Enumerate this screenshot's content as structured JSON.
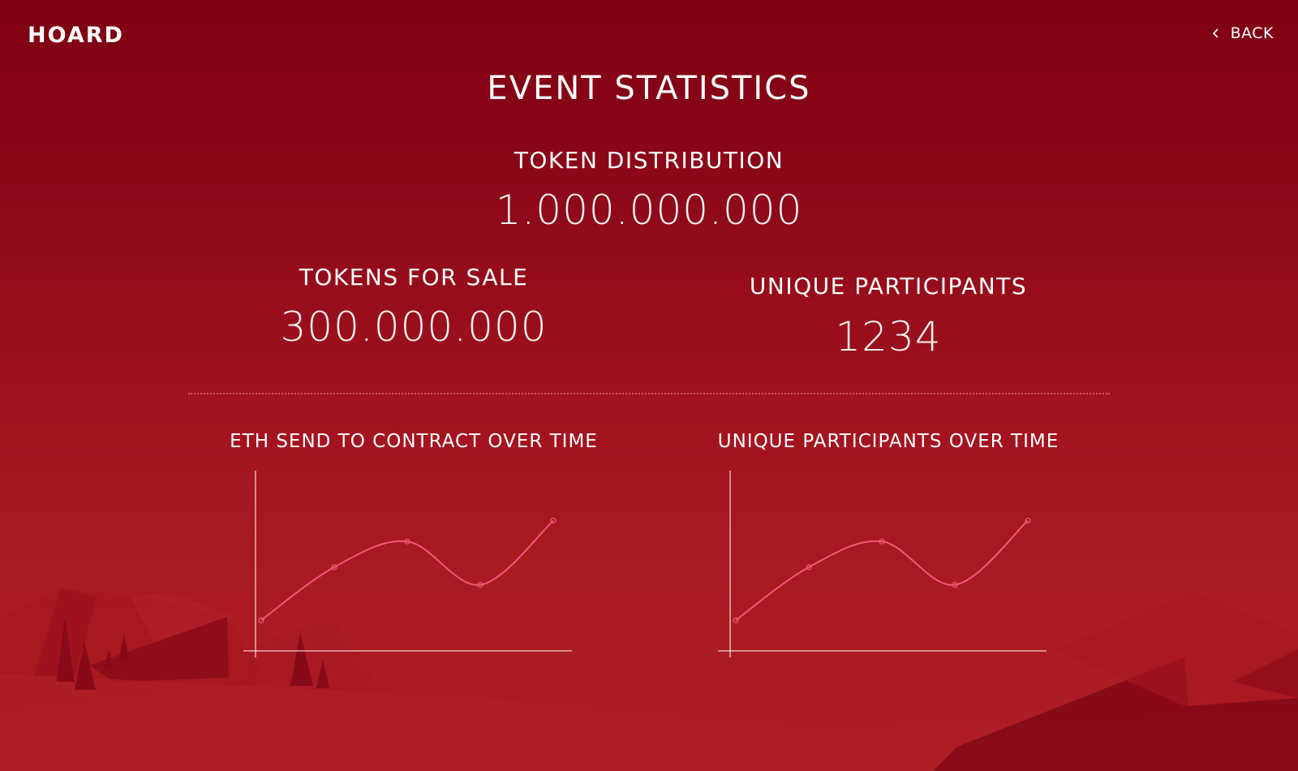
{
  "header": {
    "logo_text": "HOARD",
    "back_label": "BACK"
  },
  "page_title": "EVENT STATISTICS",
  "stats": {
    "token_distribution": {
      "label": "TOKEN DISTRIBUTION",
      "value": "1.000.000.000"
    },
    "tokens_for_sale": {
      "label": "TOKENS FOR SALE",
      "value": "300.000.000"
    },
    "unique_participants": {
      "label": "UNIQUE PARTICIPANTS",
      "value": "1234"
    }
  },
  "colors": {
    "accent": "#f15a78",
    "background_top": "#7d0012",
    "background_bottom": "#b01d24"
  },
  "chart_data": [
    {
      "type": "line",
      "title": "ETH SEND TO CONTRACT OVER TIME",
      "xlabel": "",
      "ylabel": "",
      "x": [
        1,
        2,
        3,
        4,
        5
      ],
      "series": [
        {
          "values": [
            10,
            43,
            59,
            32,
            72
          ]
        }
      ],
      "ylim": [
        0,
        100
      ],
      "grid": false
    },
    {
      "type": "line",
      "title": "UNIQUE PARTICIPANTS OVER TIME",
      "xlabel": "",
      "ylabel": "",
      "x": [
        1,
        2,
        3,
        4,
        5
      ],
      "series": [
        {
          "values": [
            10,
            43,
            59,
            32,
            72
          ]
        }
      ],
      "ylim": [
        0,
        100
      ],
      "grid": false
    }
  ]
}
